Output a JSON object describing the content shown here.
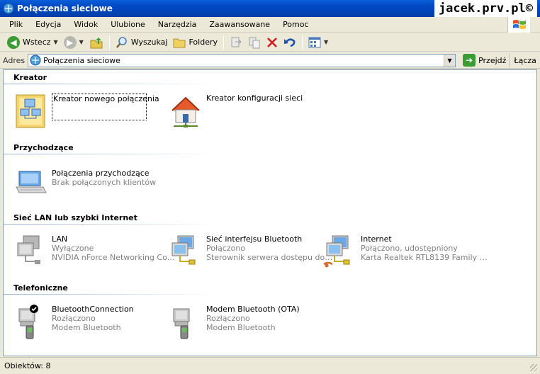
{
  "window": {
    "title": "Połączenia sieciowe",
    "watermark": "jacek.prv.pl©"
  },
  "menu": [
    "Plik",
    "Edycja",
    "Widok",
    "Ulubione",
    "Narzędzia",
    "Zaawansowane",
    "Pomoc"
  ],
  "toolbar": {
    "back_label": "Wstecz",
    "search_label": "Wyszukaj",
    "folders_label": "Foldery"
  },
  "address": {
    "label": "Adres",
    "value": "Połączenia sieciowe",
    "go_label": "Przejdź",
    "links_label": "Łącza"
  },
  "groups": [
    {
      "title": "Kreator",
      "items": [
        {
          "name": "Kreator nowego połączenia",
          "line2": "",
          "line3": ""
        },
        {
          "name": "Kreator konfiguracji sieci",
          "line2": "",
          "line3": ""
        }
      ]
    },
    {
      "title": "Przychodzące",
      "items": [
        {
          "name": "Połączenia przychodzące",
          "line2": "Brak połączonych klientów",
          "line3": ""
        }
      ]
    },
    {
      "title": "Sieć LAN lub szybki Internet",
      "items": [
        {
          "name": "LAN",
          "line2": "Wyłączone",
          "line3": "NVIDIA nForce Networking Co…"
        },
        {
          "name": "Sieć interfejsu Bluetooth",
          "line2": "Połączono",
          "line3": "Sterownik serwera dostępu do…"
        },
        {
          "name": "Internet",
          "line2": "Połączono, udostępniony",
          "line3": "Karta Realtek RTL8139 Family …"
        }
      ]
    },
    {
      "title": "Telefoniczne",
      "items": [
        {
          "name": "BluetoothConnection",
          "line2": "Rozłączono",
          "line3": "Modem Bluetooth"
        },
        {
          "name": "Modem Bluetooth (OTA)",
          "line2": "Rozłączono",
          "line3": "Modem Bluetooth"
        }
      ]
    }
  ],
  "status": {
    "text": "Obiektów: 8"
  },
  "colors": {
    "titlebar": "#0148c2",
    "accent_line": "#9cb8d8",
    "gray_text": "#808080"
  }
}
